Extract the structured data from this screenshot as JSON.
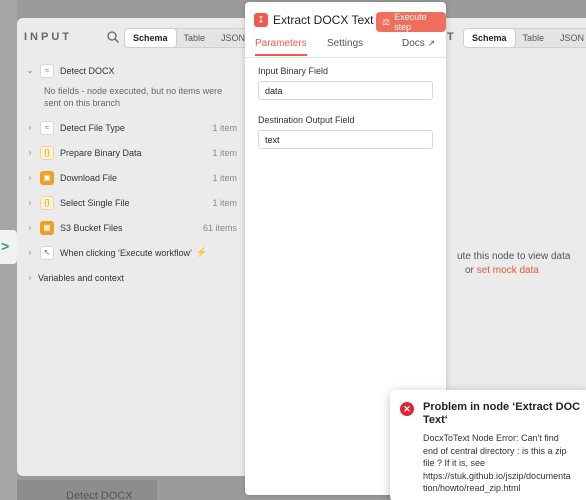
{
  "input_panel": {
    "title": "INPUT",
    "tabs": [
      "Schema",
      "Table",
      "JSON"
    ],
    "active_tab": "Schema",
    "items": [
      {
        "label": "Detect DOCX",
        "count": "",
        "icon": "wifi-icon",
        "expanded": true,
        "note": "No fields - node executed, but no items were sent on this branch"
      },
      {
        "label": "Detect File Type",
        "count": "1 item",
        "icon": "wifi-icon"
      },
      {
        "label": "Prepare Binary Data",
        "count": "1 item",
        "icon": "braces-icon"
      },
      {
        "label": "Download File",
        "count": "1 item",
        "icon": "download-icon"
      },
      {
        "label": "Select Single File",
        "count": "1 item",
        "icon": "braces-icon"
      },
      {
        "label": "S3 Bucket Files",
        "count": "61 items",
        "icon": "s3-icon"
      },
      {
        "label": "When clicking ‘Execute workflow’",
        "count": "",
        "icon": "cursor-click-icon"
      }
    ],
    "variables_label": "Variables and context"
  },
  "node_panel": {
    "title": "Extract DOCX Text",
    "execute_label": "Execute step",
    "tabs": {
      "parameters": "Parameters",
      "settings": "Settings",
      "docs": "Docs"
    },
    "fields": [
      {
        "label": "Input Binary Field",
        "value": "data"
      },
      {
        "label": "Destination Output Field",
        "value": "text"
      }
    ]
  },
  "output_panel": {
    "title_fragment": "T",
    "tabs": [
      "Schema",
      "Table",
      "JSON"
    ],
    "active_tab": "Schema",
    "message_prefix": "ute this node to view data",
    "message_or": "or",
    "message_link": "set mock data"
  },
  "toast": {
    "title": "Problem in node ‘Extract DOC Text‘",
    "body": "DocxToText Node Error: Can't find end of central directory : is this a zip file ? If it is, see https://stuk.github.io/jszip/documentation/howto/read_zip.html"
  },
  "background": {
    "bottom_label": "Detect DOCX"
  },
  "colors": {
    "accent": "#ef5b4c",
    "error": "#e0253a",
    "success": "#2e9e6b"
  }
}
